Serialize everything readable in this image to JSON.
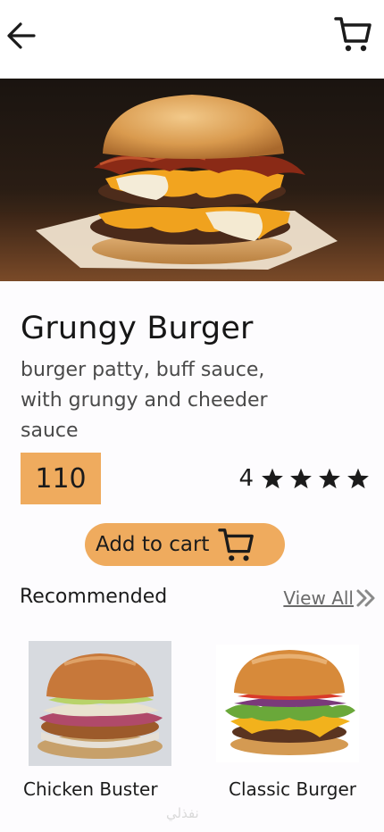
{
  "header": {
    "back_icon": "arrow-left-icon",
    "cart_icon": "shopping-cart-icon"
  },
  "product": {
    "name": "Grungy Burger",
    "description": "burger patty, buff sauce, with grungy and cheeder sauce",
    "price": "110",
    "rating": "4",
    "stars": 4,
    "accent_color": "#efab5e"
  },
  "actions": {
    "add_to_cart_label": "Add to cart"
  },
  "recommended": {
    "heading": "Recommended",
    "view_all_label": "View All",
    "items": [
      {
        "name": "Chicken Buster"
      },
      {
        "name": "Classic Burger"
      }
    ]
  },
  "watermark": "نفذلي"
}
